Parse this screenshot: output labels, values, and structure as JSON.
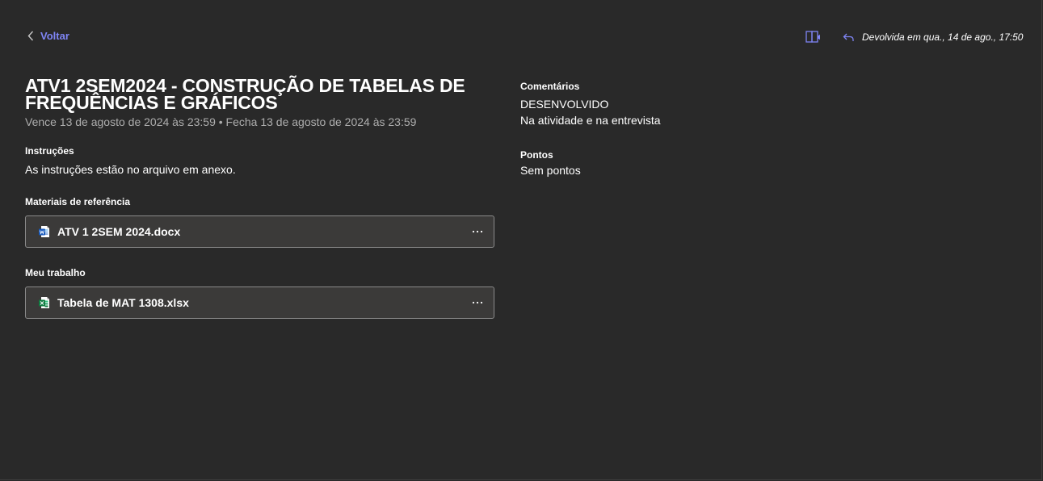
{
  "header": {
    "back_label": "Voltar",
    "status_text": "Devolvida em qua., 14 de ago., 17:50"
  },
  "assignment": {
    "title": "ATV1 2SEM2024 - CONSTRUÇÃO DE TABELAS DE FREQUÊNCIAS E GRÁFICOS",
    "due_text": "Vence 13 de agosto de 2024 às 23:59 • Fecha 13 de agosto de 2024 às 23:59"
  },
  "instructions": {
    "label": "Instruções",
    "text": "As instruções estão no arquivo em anexo."
  },
  "reference_materials": {
    "label": "Materiais de referência",
    "files": [
      {
        "name": "ATV 1 2SEM 2024.docx",
        "icon": "word-file-icon"
      }
    ]
  },
  "my_work": {
    "label": "Meu trabalho",
    "files": [
      {
        "name": "Tabela de MAT 1308.xlsx",
        "icon": "excel-file-icon"
      }
    ]
  },
  "comments": {
    "label": "Comentários",
    "line1": "DESENVOLVIDO",
    "line2": "Na atividade e na entrevista"
  },
  "points": {
    "label": "Pontos",
    "value": "Sem pontos"
  },
  "colors": {
    "background": "#292929",
    "accent": "#7f85f5",
    "card": "#3b3a39",
    "muted_text": "#adadad"
  }
}
